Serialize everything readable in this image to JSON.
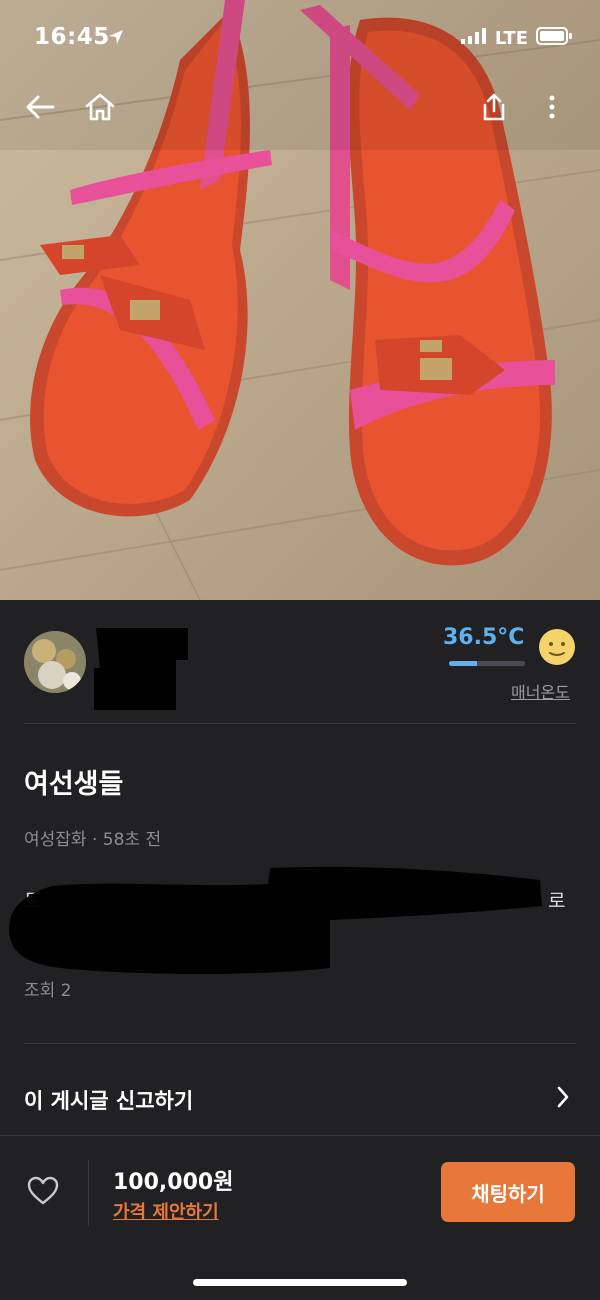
{
  "status_bar": {
    "time": "16:45",
    "network": "LTE"
  },
  "nav": {
    "back_icon": "arrow-left-icon",
    "home_icon": "home-icon",
    "share_icon": "share-icon",
    "more_icon": "more-vertical-icon"
  },
  "seller": {
    "temperature": "36.5°C",
    "temperature_level": 0.365,
    "manner_label": "매너온도",
    "mood_icon": "smiley-face-icon"
  },
  "post": {
    "title": "여선생들",
    "meta": "여성잡화 · 58초 전",
    "desc_visible_start": "토",
    "desc_visible_end": "로",
    "views": "조회 2"
  },
  "report": {
    "label": "이 게시글 신고하기"
  },
  "bottom": {
    "price": "100,000원",
    "offer_label": "가격 제안하기",
    "chat_label": "채팅하기"
  },
  "colors": {
    "accent": "#e8783a",
    "temperature": "#5fb0ec",
    "background": "#212124"
  }
}
